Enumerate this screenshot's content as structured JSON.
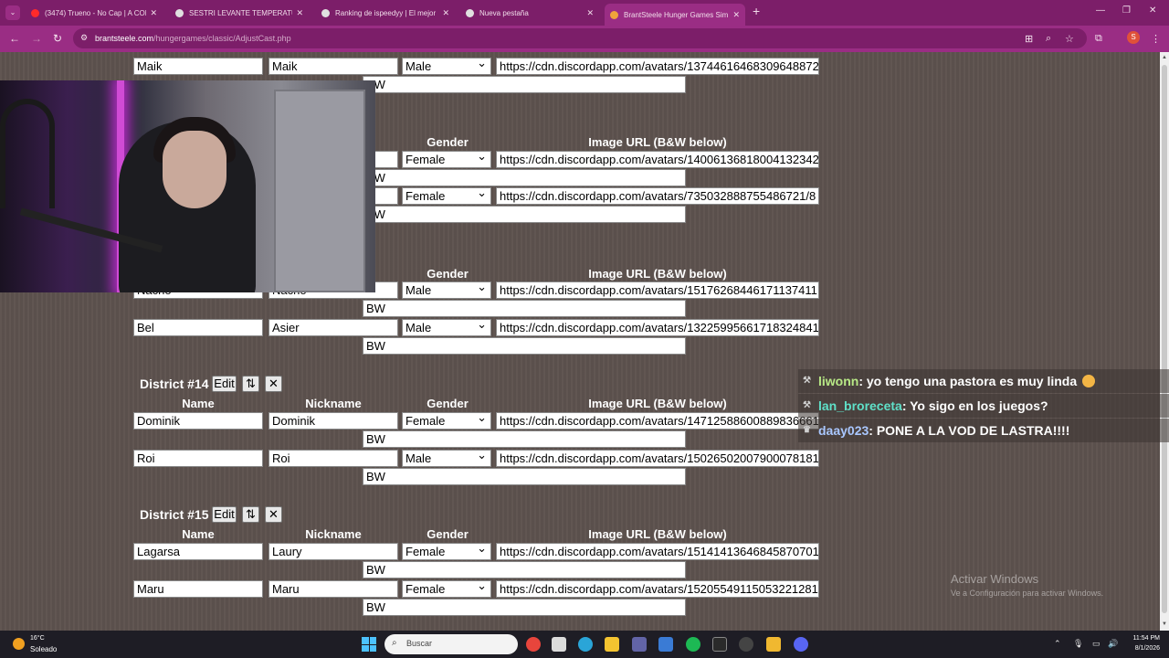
{
  "browser": {
    "tabs": [
      {
        "title": "(3474) Trueno - No Cap | A COL",
        "fav": "#ff2a2a"
      },
      {
        "title": "SESTRI LEVANTE TEMPERATURE",
        "fav": "#e0e0e0"
      },
      {
        "title": "Ranking de ispeedyy | El mejor",
        "fav": "#e0e0e0"
      },
      {
        "title": "Nueva pestaña",
        "fav": "#e0e0e0"
      },
      {
        "title": "BrantSteele Hunger Games Sim",
        "fav": "#f0a33a"
      }
    ],
    "url_domain": "brantsteele.com",
    "url_path": "/hungergames/classic/AdjustCast.php",
    "profile_initial": "S"
  },
  "headers": {
    "name": "Name",
    "nickname": "Nickname",
    "gender": "Gender",
    "image_url": "Image URL (B&W below)"
  },
  "bw_label": "BW",
  "edit_label": "Edit",
  "sort_label": "⇅",
  "delete_label": "✕",
  "groups": [
    {
      "district": "",
      "rows": [
        {
          "name": "Maik",
          "nickname": "Maik",
          "gender": "Male",
          "url": "https://cdn.discordapp.com/avatars/13744616468309648872"
        }
      ]
    },
    {
      "district": "",
      "rows": [
        {
          "name": "",
          "nickname": "",
          "gender": "Female",
          "url": "https://cdn.discordapp.com/avatars/14006136818004132342"
        },
        {
          "name": "",
          "nickname": "",
          "gender": "Female",
          "url": "https://cdn.discordapp.com/avatars/735032888755486721/8"
        }
      ]
    },
    {
      "district": "",
      "rows": [
        {
          "name": "Nacho",
          "nickname": "Nacho",
          "gender": "Male",
          "url": "https://cdn.discordapp.com/avatars/15176268446171137411"
        },
        {
          "name": "Bel",
          "nickname": "Asier",
          "gender": "Male",
          "url": "https://cdn.discordapp.com/avatars/13225995661718324841"
        }
      ]
    },
    {
      "district": "District #14",
      "rows": [
        {
          "name": "Dominik",
          "nickname": "Dominik",
          "gender": "Female",
          "url": "https://cdn.discordapp.com/avatars/14712588600889836661"
        },
        {
          "name": "Roi",
          "nickname": "Roi",
          "gender": "Male",
          "url": "https://cdn.discordapp.com/avatars/15026502007900078181"
        }
      ]
    },
    {
      "district": "District #15",
      "rows": [
        {
          "name": "Lagarsa",
          "nickname": "Laury",
          "gender": "Female",
          "url": "https://cdn.discordapp.com/avatars/15141413646845870701"
        },
        {
          "name": "Maru",
          "nickname": "Maru",
          "gender": "Female",
          "url": "https://cdn.discordapp.com/avatars/15205549115053221281"
        }
      ]
    }
  ],
  "chat": [
    {
      "user": "liwonn",
      "message": ": yo tengo una pastora es muy linda",
      "color": "#b8e986"
    },
    {
      "user": "lan_broreceta",
      "message": ": Yo sigo en los juegos?",
      "color": "#5fe0c8"
    },
    {
      "user": "daay023",
      "message": ": PONE A LA VOD DE LASTRA!!!!",
      "color": "#a9c7ff"
    }
  ],
  "watermark": {
    "line1": "Activar Windows",
    "line2": "Ve a Configuración para activar Windows."
  },
  "taskbar": {
    "temp": "16°C",
    "condition": "Soleado",
    "search_placeholder": "Buscar",
    "time": "11:54 PM",
    "date": "8/1/2026"
  }
}
